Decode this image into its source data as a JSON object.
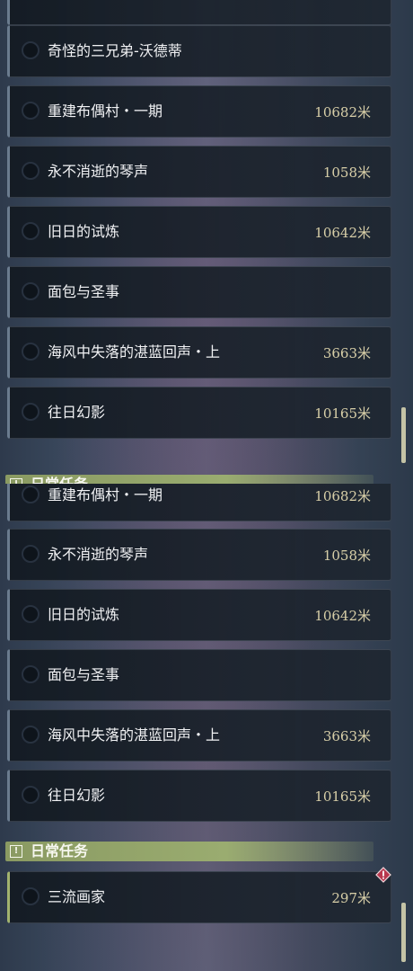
{
  "top_panel": {
    "rows": [
      {
        "name": "奇怪的三兄弟-沃德蒂",
        "distance": ""
      },
      {
        "name": "重建布偶村・一期",
        "distance": "10682米"
      },
      {
        "name": "永不消逝的琴声",
        "distance": "1058米"
      },
      {
        "name": "旧日的试炼",
        "distance": "10642米"
      },
      {
        "name": "面包与圣事",
        "distance": ""
      },
      {
        "name": "海风中失落的湛蓝回声・上",
        "distance": "3663米"
      },
      {
        "name": "往日幻影",
        "distance": "10165米"
      }
    ],
    "section_title": "日常任务"
  },
  "bottom_panel": {
    "rows": [
      {
        "name": "重建布偶村・一期",
        "distance": "10682米"
      },
      {
        "name": "永不消逝的琴声",
        "distance": "1058米"
      },
      {
        "name": "旧日的试炼",
        "distance": "10642米"
      },
      {
        "name": "面包与圣事",
        "distance": ""
      },
      {
        "name": "海风中失落的湛蓝回声・上",
        "distance": "3663米"
      },
      {
        "name": "往日幻影",
        "distance": "10165米"
      }
    ],
    "section_title": "日常任务",
    "daily_rows": [
      {
        "name": "三流画家",
        "distance": "297米"
      }
    ]
  },
  "icons": {
    "section": "exclamation-box-icon",
    "alert": "exclamation-diamond-icon",
    "status": "empty-circle-icon"
  },
  "colors": {
    "accent_daily": "#a2b36f",
    "distance": "#d8cfa8",
    "alert": "#b8384e"
  }
}
